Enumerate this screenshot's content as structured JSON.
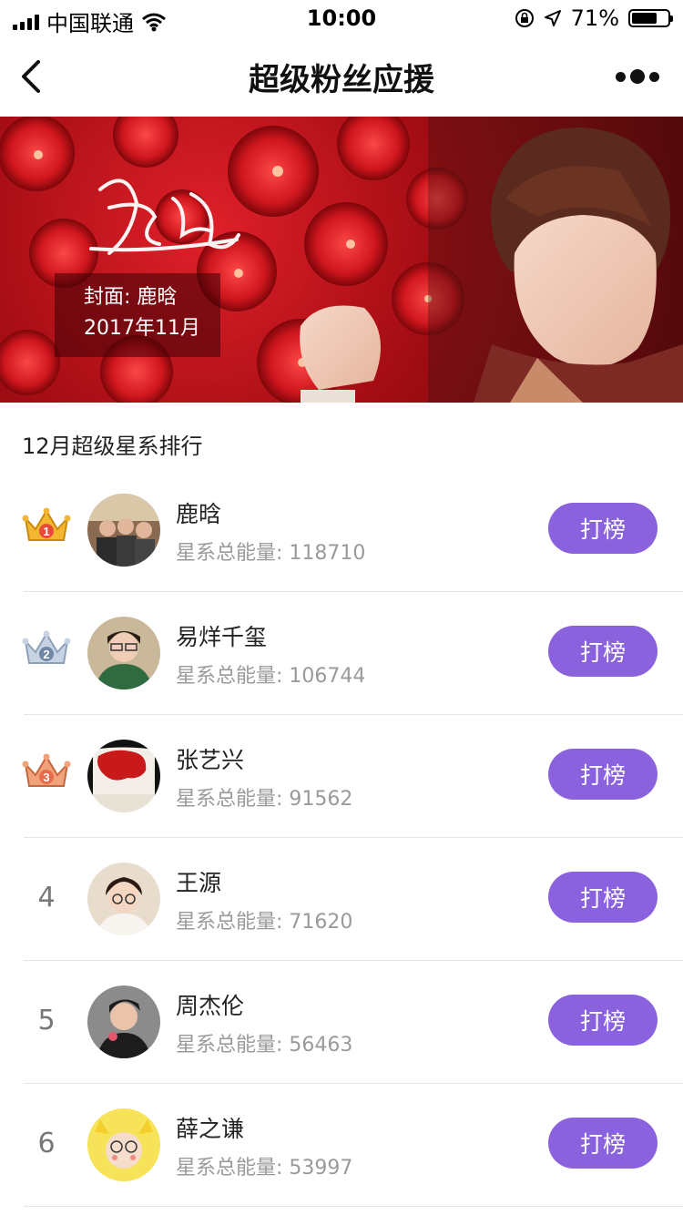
{
  "status_bar": {
    "carrier": "中国联通",
    "time": "10:00",
    "battery_percent": "71%",
    "battery_level": 0.71,
    "icons": [
      "signal-icon",
      "wifi-icon",
      "orientation-lock-icon",
      "location-icon",
      "battery-icon"
    ]
  },
  "nav": {
    "title": "超级粉丝应援",
    "back_icon": "chevron-left-icon",
    "more_icon": "more-dots-icon"
  },
  "banner": {
    "signature": "鹿晗",
    "cover_line1": "封面: 鹿晗",
    "cover_line2": "2017年11月"
  },
  "section_title": "12月超级星系排行",
  "ranking": [
    {
      "rank": "1",
      "name": "鹿晗",
      "energy": "星系总能量: 118710",
      "button": "打榜",
      "badge": "gold-crown-icon"
    },
    {
      "rank": "2",
      "name": "易烊千玺",
      "energy": "星系总能量: 106744",
      "button": "打榜",
      "badge": "silver-crown-icon"
    },
    {
      "rank": "3",
      "name": "张艺兴",
      "energy": "星系总能量: 91562",
      "button": "打榜",
      "badge": "bronze-crown-icon"
    },
    {
      "rank": "4",
      "name": "王源",
      "energy": "星系总能量: 71620",
      "button": "打榜"
    },
    {
      "rank": "5",
      "name": "周杰伦",
      "energy": "星系总能量: 56463",
      "button": "打榜"
    },
    {
      "rank": "6",
      "name": "薛之谦",
      "energy": "星系总能量: 53997",
      "button": "打榜"
    }
  ],
  "colors": {
    "accent": "#8b62dd",
    "banner_red": "#c0141c",
    "gold": "#f2b630",
    "silver": "#b8c6d8",
    "bronze": "#e98a5a"
  }
}
